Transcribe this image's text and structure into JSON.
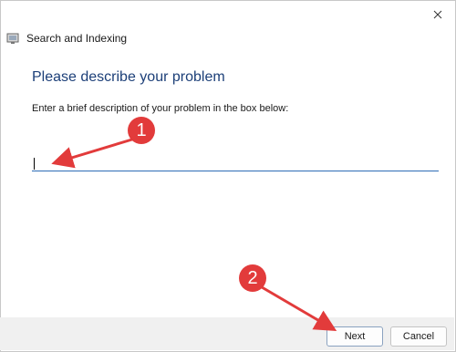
{
  "window": {
    "title": "Search and Indexing",
    "close_icon": "close-icon"
  },
  "page": {
    "heading": "Please describe your problem",
    "instruction": "Enter a brief description of your problem in the box below:"
  },
  "description_input": {
    "value": "",
    "placeholder": ""
  },
  "buttons": {
    "next": "Next",
    "cancel": "Cancel"
  },
  "annotations": {
    "marker_1": "1",
    "marker_2": "2",
    "color": "#e23b3b"
  }
}
